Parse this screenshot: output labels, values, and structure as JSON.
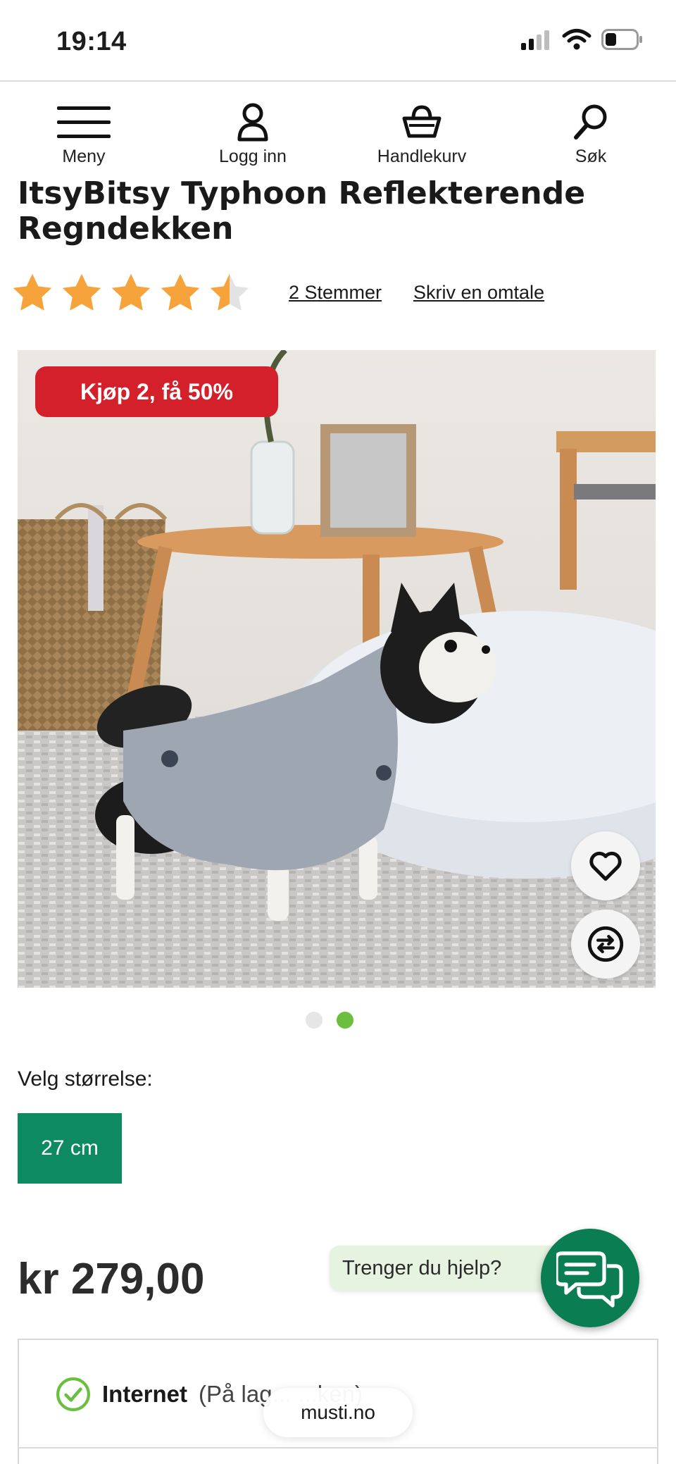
{
  "status_bar": {
    "time": "19:14"
  },
  "nav": {
    "menu_label": "Meny",
    "login_label": "Logg inn",
    "cart_label": "Handlekurv",
    "search_label": "Søk"
  },
  "product": {
    "title": "ItsyBitsy Typhoon Reflekterende Regndekken",
    "rating": 4.5,
    "rating_max": 5,
    "votes_link": "2 Stemmer",
    "review_link": "Skriv en omtale",
    "promo_badge": "Kjøp 2, få 50%",
    "image_count": 2,
    "active_image_index": 2,
    "size_label": "Velg størrelse:",
    "selected_size": "27 cm",
    "price": "kr 279,00"
  },
  "help": {
    "bubble_text": "Trenger du hjelp?"
  },
  "delivery": {
    "option_title": "Internet",
    "option_detail": "(På lag... ...ken)"
  },
  "browser": {
    "url": "musti.no"
  },
  "colors": {
    "brand_green": "#0e8a63",
    "promo_red": "#d3202a",
    "star_orange": "#f5a33a",
    "dot_active": "#6abf3f"
  }
}
